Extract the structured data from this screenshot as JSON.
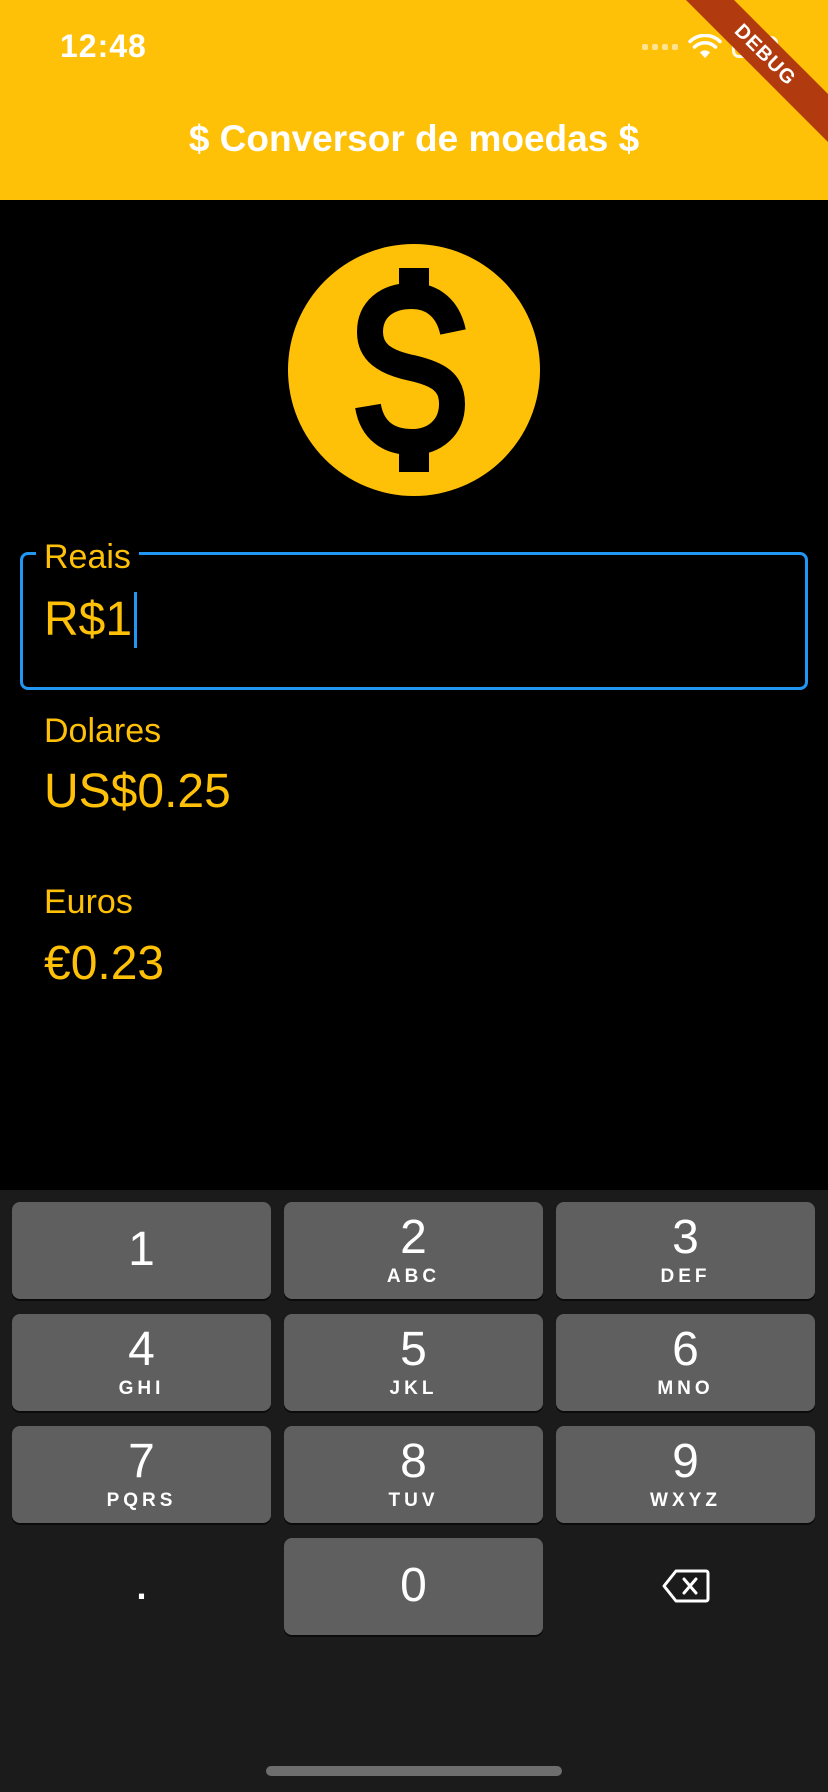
{
  "status_bar": {
    "time": "12:48"
  },
  "app_bar": {
    "title": "$ Conversor de moedas $",
    "debug_banner": "DEBUG",
    "background_color": "#FFC107"
  },
  "logo": {
    "icon": "dollar-coin-icon",
    "color": "#FFC107"
  },
  "fields": {
    "reais": {
      "label": "Reais",
      "value": "R$1"
    },
    "dolares": {
      "label": "Dolares",
      "value": "US$0.25"
    },
    "euros": {
      "label": "Euros",
      "value": "€0.23"
    }
  },
  "keyboard": {
    "keys": [
      {
        "num": "1",
        "letters": ""
      },
      {
        "num": "2",
        "letters": "ABC"
      },
      {
        "num": "3",
        "letters": "DEF"
      },
      {
        "num": "4",
        "letters": "GHI"
      },
      {
        "num": "5",
        "letters": "JKL"
      },
      {
        "num": "6",
        "letters": "MNO"
      },
      {
        "num": "7",
        "letters": "PQRS"
      },
      {
        "num": "8",
        "letters": "TUV"
      },
      {
        "num": "9",
        "letters": "WXYZ"
      },
      {
        "num": "0",
        "letters": ""
      }
    ],
    "decimal": ".",
    "delete_icon": "backspace-icon"
  },
  "colors": {
    "accent": "#FFC107",
    "focus": "#2196F3",
    "background": "#000000"
  }
}
